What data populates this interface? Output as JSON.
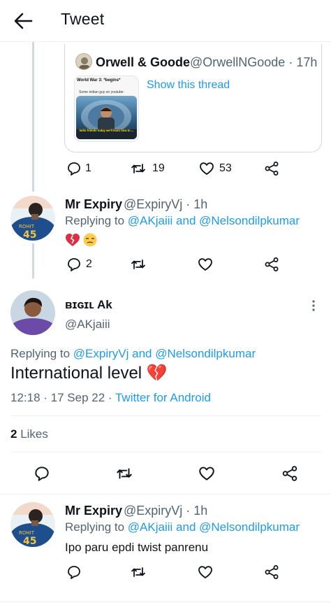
{
  "header": {
    "title": "Tweet"
  },
  "quoted_tweet": {
    "name": "Orwell & Goode",
    "handle": "@OrwellNGoode",
    "time": "17h",
    "image_title": "World War 3: *begins*",
    "image_sub": "Some indian guy on youtube:",
    "image_caption": "hello friends today we'll learn how to ...",
    "show_thread": "Show this thread",
    "replies": "1",
    "retweets": "19",
    "likes": "53"
  },
  "reply1": {
    "name": "Mr Expiry",
    "handle": "@ExpiryVj",
    "time": "1h",
    "replying_prefix": "Replying to",
    "replying_to_1": "@AKjaiii",
    "replying_and": "and",
    "replying_to_2": "@Nelsondilpkumar",
    "emoji_text": "💔😒",
    "replies": "2",
    "jersey_name": "ROHIT",
    "jersey_number": "45"
  },
  "main_tweet": {
    "name": "ʙɪɢɪʟ Ak",
    "handle": "@AKjaiii",
    "replying_prefix": "Replying to",
    "replying_to_1": "@ExpiryVj",
    "replying_and": "and",
    "replying_to_2": "@Nelsondilpkumar",
    "text": "International level 💔",
    "timestamp": "12:18 · 17 Sep 22 ·",
    "client": "Twitter for Android",
    "likes_count": "2",
    "likes_label": "Likes"
  },
  "reply2": {
    "name": "Mr Expiry",
    "handle": "@ExpiryVj",
    "time": "1h",
    "replying_prefix": "Replying to",
    "replying_to_1": "@AKjaiii",
    "replying_and": "and",
    "replying_to_2": "@Nelsondilpkumar",
    "text": "Ipo paru epdi twist panrenu",
    "jersey_name": "ROHIT",
    "jersey_number": "45"
  },
  "icons": {
    "back": "arrow-left-icon",
    "reply": "reply-icon",
    "retweet": "retweet-icon",
    "like": "heart-icon",
    "share": "share-icon",
    "more": "more-vertical-icon"
  },
  "colors": {
    "link": "#1d9bf0",
    "muted": "#536471",
    "text": "#0f1419",
    "divider": "#eff3f4"
  }
}
